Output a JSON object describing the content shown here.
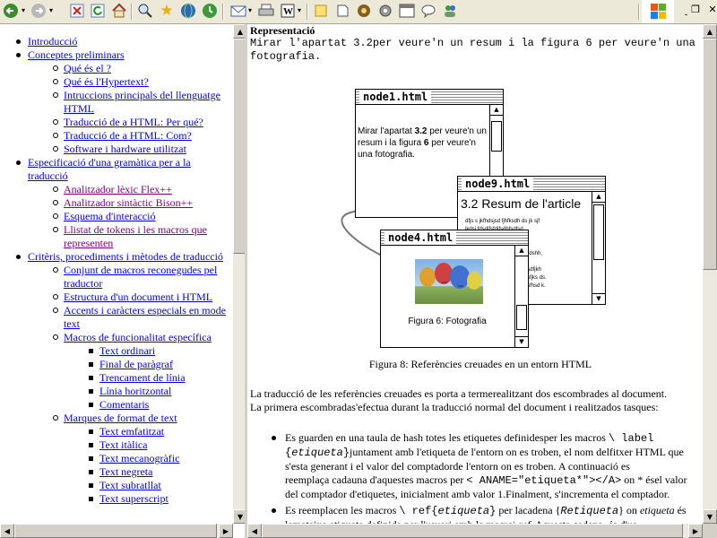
{
  "toolbar": {
    "buttons": [
      "back-icon",
      "forward-icon",
      "stop-icon",
      "refresh-icon",
      "home-icon",
      "search-icon",
      "favorites-icon",
      "media-icon",
      "history-icon",
      "mail-icon",
      "print-icon",
      "edit-icon",
      "discuss-icon",
      "messenger-icon",
      "tools-icon",
      "icon-a",
      "icon-b",
      "icon-c"
    ]
  },
  "window_controls": {
    "minimize": "_",
    "restore": "❐",
    "close": "✕"
  },
  "nav": {
    "items": [
      {
        "level": 1,
        "label": "Introducció"
      },
      {
        "level": 1,
        "label": "Conceptes preliminars"
      },
      {
        "level": 2,
        "label": "Qué és el ?"
      },
      {
        "level": 2,
        "label": "Qué és l'Hypertext?"
      },
      {
        "level": 2,
        "label": "Intruccions principals del llenguatge HTML"
      },
      {
        "level": 2,
        "label": "Traducció de a HTML: Per qué?"
      },
      {
        "level": 2,
        "label": "Traducció de a HTML: Com?"
      },
      {
        "level": 2,
        "label": "Software i hardware utilitzat"
      },
      {
        "level": 1,
        "label": "Especificació d'una gramàtica per a la traducció"
      },
      {
        "level": 2,
        "label": "Analitzador lèxic Flex++",
        "visited": true
      },
      {
        "level": 2,
        "label": "Analitzador sintàctic Bison++",
        "visited": true
      },
      {
        "level": 2,
        "label": "Esquema d'interacció"
      },
      {
        "level": 2,
        "label": "Llistat de tokens i les macros que representen",
        "visited": true
      },
      {
        "level": 1,
        "label": "Critèris, procediments i mètodes de traducció"
      },
      {
        "level": 2,
        "label": "Conjunt de macros reconegudes pel traductor"
      },
      {
        "level": 2,
        "label": "Estructura d'un document i HTML"
      },
      {
        "level": 2,
        "label": "Accents i caràcters especials en mode text"
      },
      {
        "level": 2,
        "label": "Macros de funcionalitat específica"
      },
      {
        "level": 3,
        "label": "Text ordinari"
      },
      {
        "level": 3,
        "label": "Final de paràgraf"
      },
      {
        "level": 3,
        "label": "Trencament de línia"
      },
      {
        "level": 3,
        "label": "Línia horitzontal"
      },
      {
        "level": 3,
        "label": "Comentaris"
      },
      {
        "level": 2,
        "label": "Marques de format de text"
      },
      {
        "level": 3,
        "label": "Text emfatitzat"
      },
      {
        "level": 3,
        "label": "Text itàlica"
      },
      {
        "level": 3,
        "label": "Text mecanogràfic"
      },
      {
        "level": 3,
        "label": "Text negreta"
      },
      {
        "level": 3,
        "label": "Text subratllat"
      },
      {
        "level": 3,
        "label": "Text superscript"
      }
    ]
  },
  "content": {
    "heading": "Representació",
    "intro_line1": "Mirar l'apartat 3.2per veure'n un resum i la figura 6 per veure'n una",
    "intro_line2": "fotografia.",
    "node1": {
      "title": "node1.html",
      "text_a": "Mirar l'apartat ",
      "text_b": "3.2",
      "text_c": " per veure'n un resum i la figura ",
      "text_d": "6",
      "text_e": " per veure'n una fotografia."
    },
    "node9": {
      "title": "node9.html",
      "heading": "3.2 Resum de l'article",
      "lines": [
        "dfjs s jkfhdsjsd fjhfksdh ds jk sjf",
        "jkdsj fdsdjfsfdjfsdhfsdfsd.",
        "sjd",
        " ",
        "sfjsd jksdfh fjdshsdf fh sbjhdshh,",
        "sdfsdf.",
        "sfsfdsjhfsfjh sdjffhsd fjhdjksdfjkh",
        "hfsdjk sjhfdsjfhsd ksh sfkj sfjks ds.",
        "sdhjf shjfk dsjhfsdjfk hjsfhjsfhsd k."
      ]
    },
    "node4": {
      "title": "node4.html",
      "caption": "Figura 6: Fotografia"
    },
    "figure_caption": "Figura 8: Referències creuades en un entorn HTML",
    "para1_line1": "La traducció de les referències creuades es porta a termerealitzant dos escombrades al document.",
    "para1_line2": "La primera escombradas'efectua durant la traducció normal del document i realitzados tasques:",
    "bullet1": {
      "l1a": "Es guarden en una taula de hash totes les etiquetes definidesper les macros ",
      "l1b": "\\ label",
      "l2a": "{",
      "l2b": "etiqueta",
      "l2c": "}",
      "l2d": "juntament amb l'etiqueta de l'entorn on es troben, el nom delfitxer HTML que",
      "l3": "s'esta generant i el valor del comptadorde l'entorn on es troben. A continuació es",
      "l4a": "reemplaça cadauna d'aquestes macros per ",
      "l4b": "< ANAME=\"etiqueta*\"></A>",
      "l4c": " on * ésel valor",
      "l5": "del comptador d'etiquetes, inicialment amb valor 1.Finalment, s'incrementa el comptador."
    },
    "bullet2": {
      "l1a": "Es reemplacen les macros ",
      "l1b": "\\ ref{",
      "l1c": "etiqueta",
      "l1d": "}",
      "l1e": " per lacadena {",
      "l1f": "Retiqueta",
      "l1g": "} on ",
      "l1h": "etiqueta",
      "l1i": " és",
      "l2a": "lamateixa etiqueta definida per l'usuari amb la macro",
      "l2b": "\\ ref",
      "l2c": ". Aquesta cadena, és d'us"
    }
  }
}
